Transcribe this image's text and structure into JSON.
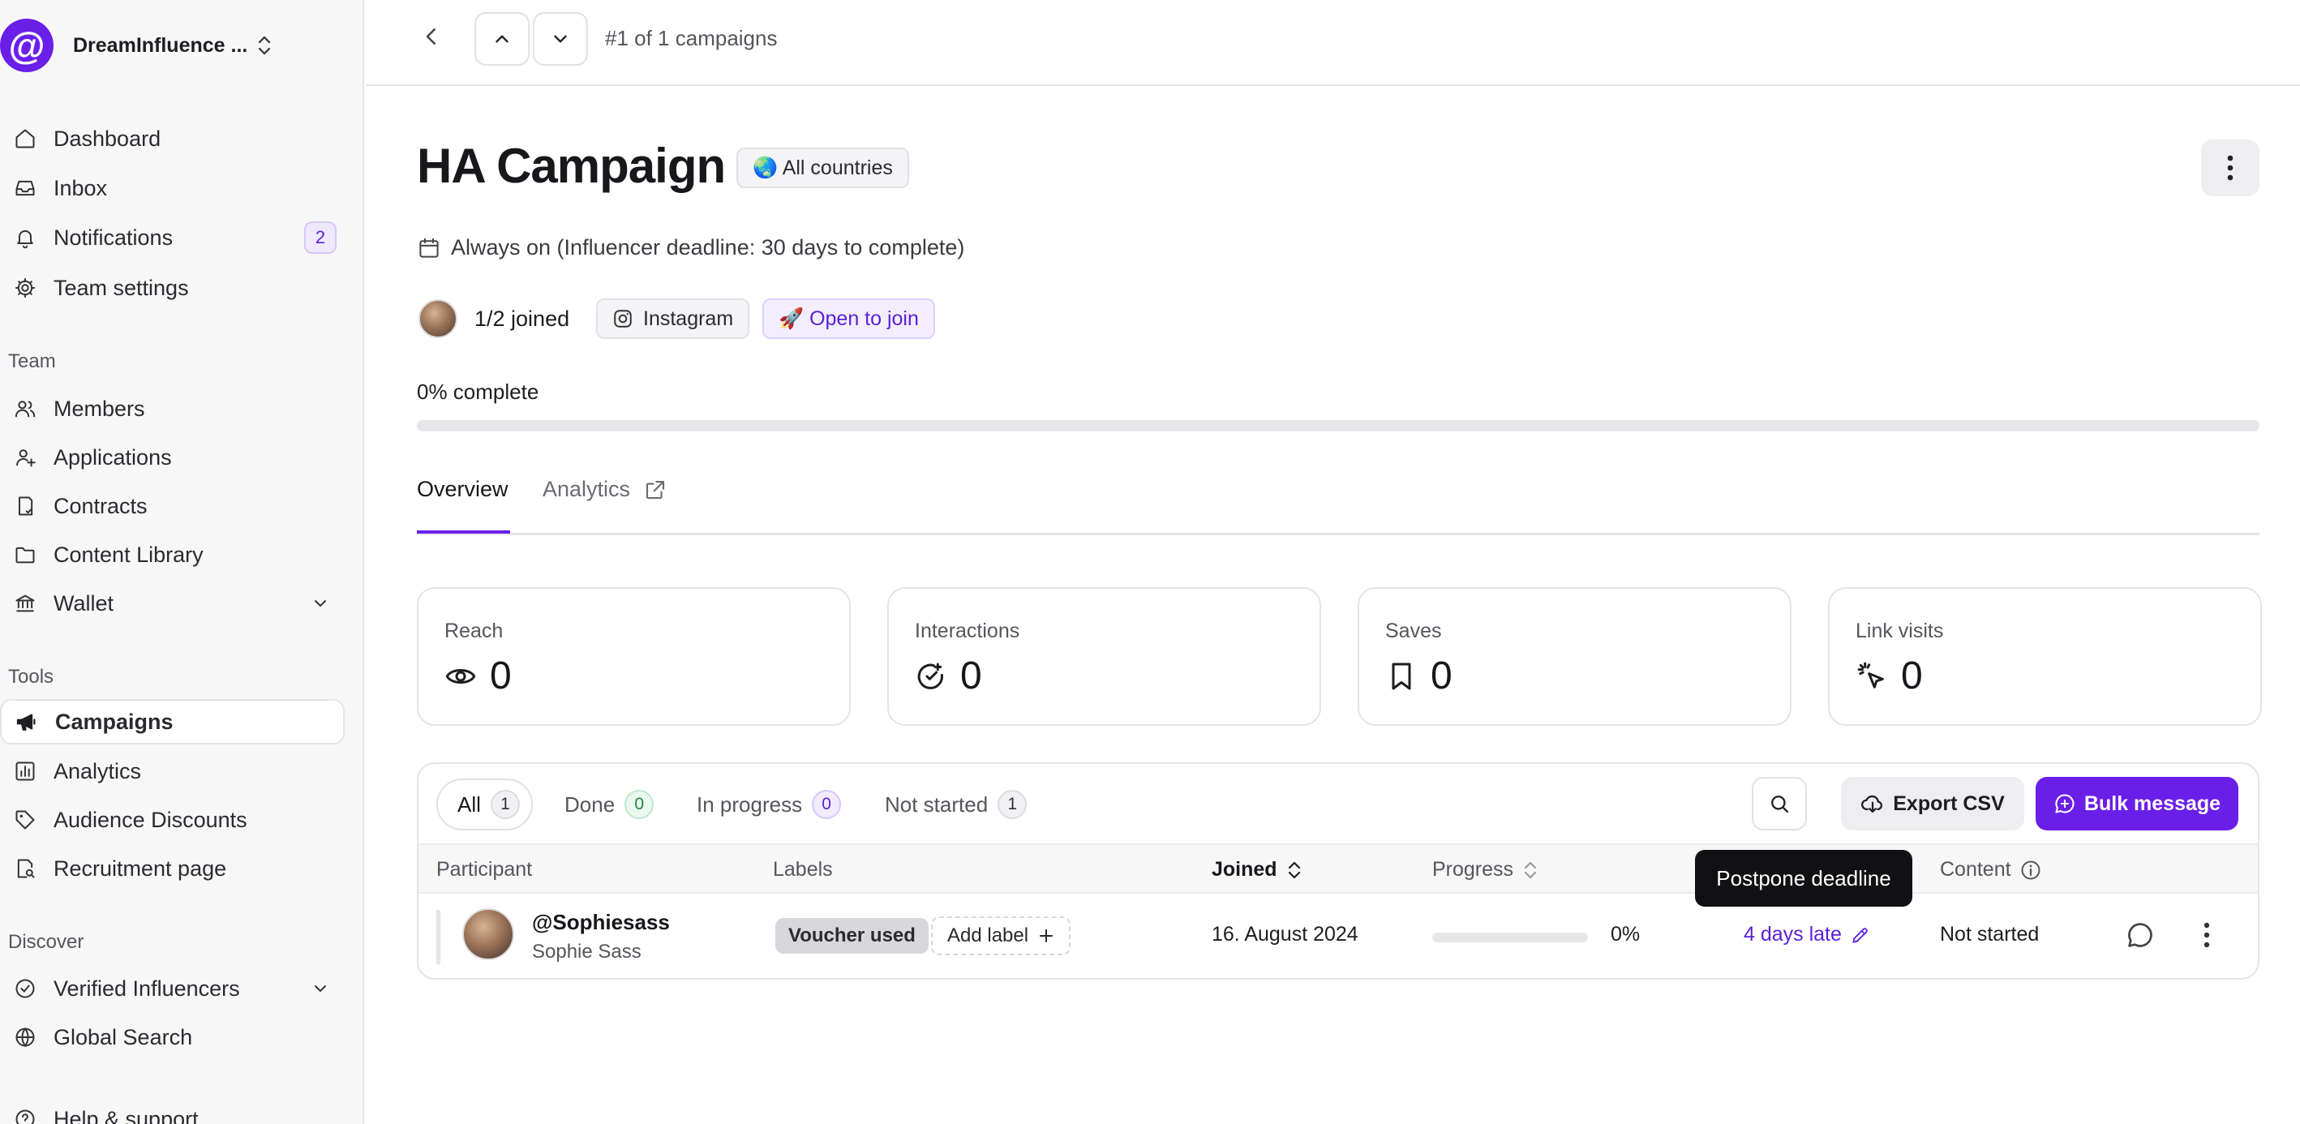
{
  "workspace": {
    "name": "DreamInfluence ...",
    "logo_glyph": "@"
  },
  "sidebar": {
    "main_items": [
      {
        "label": "Dashboard",
        "icon": "home-icon"
      },
      {
        "label": "Inbox",
        "icon": "inbox-icon"
      },
      {
        "label": "Notifications",
        "icon": "bell-icon",
        "badge": "2"
      },
      {
        "label": "Team settings",
        "icon": "gear-icon"
      }
    ],
    "team_section": "Team",
    "team_items": [
      {
        "label": "Members",
        "icon": "users-icon"
      },
      {
        "label": "Applications",
        "icon": "user-plus-icon"
      },
      {
        "label": "Contracts",
        "icon": "contract-icon"
      },
      {
        "label": "Content Library",
        "icon": "folder-icon"
      },
      {
        "label": "Wallet",
        "icon": "bank-icon"
      }
    ],
    "tools_section": "Tools",
    "tools_items": [
      {
        "label": "Campaigns",
        "icon": "megaphone-icon",
        "active": true
      },
      {
        "label": "Analytics",
        "icon": "chart-icon"
      },
      {
        "label": "Audience Discounts",
        "icon": "tag-icon"
      },
      {
        "label": "Recruitment page",
        "icon": "page-search-icon"
      }
    ],
    "discover_section": "Discover",
    "discover_items": [
      {
        "label": "Verified Influencers",
        "icon": "verified-icon"
      },
      {
        "label": "Global Search",
        "icon": "globe-icon"
      }
    ],
    "help_label": "Help & support"
  },
  "topbar": {
    "position_text": "#1 of 1 campaigns"
  },
  "campaign": {
    "title": "HA Campaign",
    "country_chip": "🌏 All countries",
    "schedule": "Always on (Influencer deadline: 30 days to complete)",
    "joined": "1/2 joined",
    "platform": "Instagram",
    "join_status": "🚀 Open to join",
    "complete_text": "0% complete",
    "complete_value": 0
  },
  "tabs": {
    "overview": "Overview",
    "analytics": "Analytics"
  },
  "stats": [
    {
      "label": "Reach",
      "value": "0",
      "icon": "eye-icon"
    },
    {
      "label": "Interactions",
      "value": "0",
      "icon": "interactions-icon"
    },
    {
      "label": "Saves",
      "value": "0",
      "icon": "bookmark-icon"
    },
    {
      "label": "Link visits",
      "value": "0",
      "icon": "cursor-click-icon"
    }
  ],
  "filters": [
    {
      "label": "All",
      "count": "1"
    },
    {
      "label": "Done",
      "count": "0"
    },
    {
      "label": "In progress",
      "count": "0"
    },
    {
      "label": "Not started",
      "count": "1"
    }
  ],
  "actions": {
    "export": "Export CSV",
    "bulk": "Bulk message"
  },
  "table": {
    "headers": {
      "participant": "Participant",
      "labels": "Labels",
      "joined": "Joined",
      "progress": "Progress",
      "content": "Content"
    },
    "rows": [
      {
        "handle": "@Sophiesass",
        "name": "Sophie Sass",
        "label": "Voucher used",
        "add_label": "Add label",
        "joined": "16. August 2024",
        "progress_text": "0%",
        "progress_value": 0,
        "deadline": "4 days late",
        "content": "Not started"
      }
    ]
  },
  "tooltip": "Postpone deadline",
  "colors": {
    "accent": "#6a1fe9",
    "sidebar_bg": "#f7f7f8"
  }
}
